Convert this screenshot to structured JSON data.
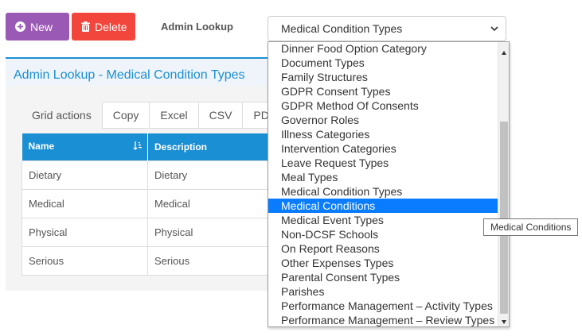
{
  "toolbar": {
    "new_label": "New",
    "delete_label": "Delete",
    "lookup_label": "Admin Lookup",
    "new_color": "#9b59b6",
    "delete_color": "#f2463c"
  },
  "select": {
    "value": "Medical Condition Types"
  },
  "panel": {
    "title": "Admin Lookup - Medical Condition Types"
  },
  "tabs": [
    "Grid actions",
    "Copy",
    "Excel",
    "CSV",
    "PDF"
  ],
  "grid": {
    "columns": [
      "Name",
      "Description"
    ],
    "rows": [
      [
        "Dietary",
        "Dietary"
      ],
      [
        "Medical",
        "Medical"
      ],
      [
        "Physical",
        "Physical"
      ],
      [
        "Serious",
        "Serious"
      ]
    ]
  },
  "dropdown": {
    "items": [
      "Dinner Food Option Category",
      "Document Types",
      "Family Structures",
      "GDPR Consent Types",
      "GDPR Method Of Consents",
      "Governor Roles",
      "Illness Categories",
      "Intervention Categories",
      "Leave Request Types",
      "Meal Types",
      "Medical Condition Types",
      "Medical Conditions",
      "Medical Event Types",
      "Non-DCSF Schools",
      "On Report Reasons",
      "Other Expenses Types",
      "Parental Consent Types",
      "Parishes",
      "Performance Management – Activity Types",
      "Performance Management – Review Types"
    ],
    "highlighted": "Medical Conditions"
  },
  "tooltip": "Medical Conditions",
  "colors": {
    "accent": "#1b8fd3",
    "highlight": "#0a7cff"
  }
}
